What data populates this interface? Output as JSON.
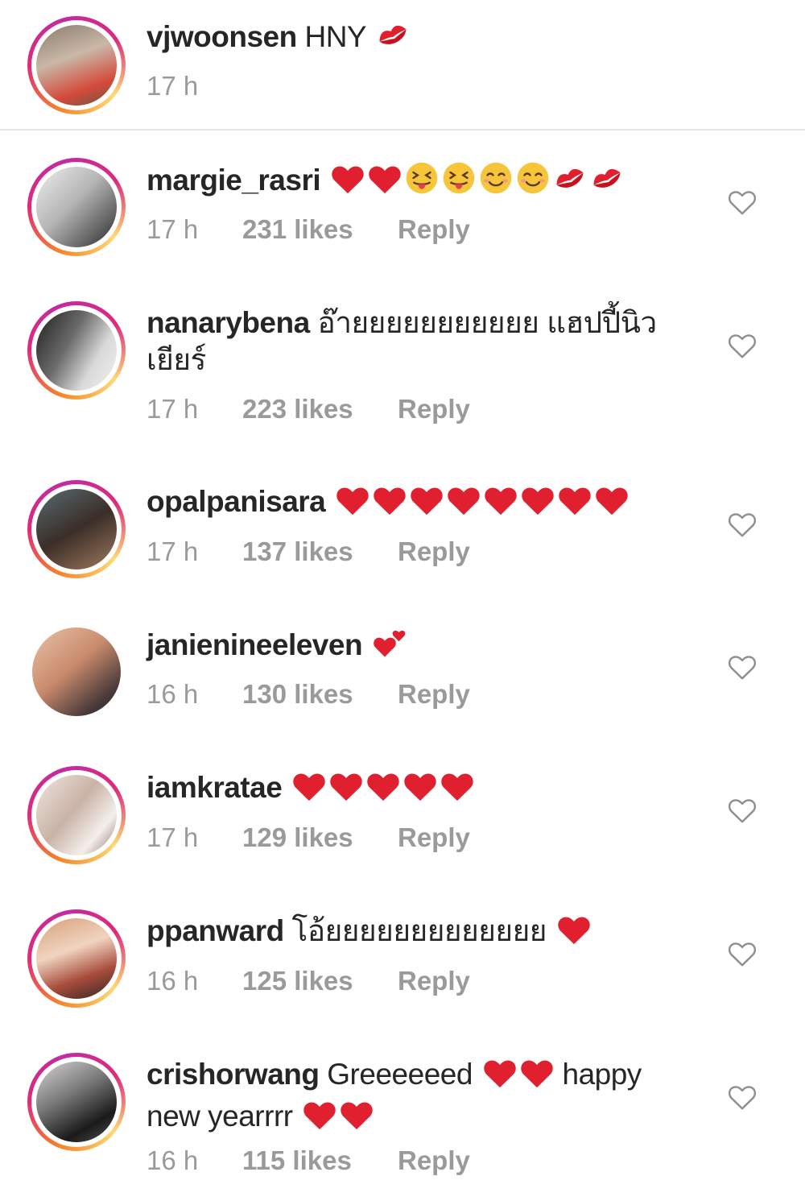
{
  "caption": {
    "username": "vjwoonsen",
    "text": "HNY",
    "emojis": [
      "kiss-mark"
    ],
    "time": "17 h"
  },
  "comments": [
    {
      "username": "margie_rasri",
      "text": "",
      "emojis": [
        "red-heart",
        "red-heart",
        "squinting-tongue-face",
        "squinting-tongue-face",
        "smiling-face",
        "smiling-face",
        "kiss-mark",
        "kiss-mark"
      ],
      "time": "17 h",
      "likes": "231 likes",
      "reply": "Reply"
    },
    {
      "username": "nanarybena",
      "text": "อ๊ายยยยยยยยยยย แฮปปี้นิวเยียร์",
      "emojis": [],
      "time": "17 h",
      "likes": "223 likes",
      "reply": "Reply"
    },
    {
      "username": "opalpanisara",
      "text": "",
      "emojis": [
        "red-heart",
        "red-heart",
        "red-heart",
        "red-heart",
        "red-heart",
        "red-heart",
        "red-heart",
        "red-heart"
      ],
      "time": "17 h",
      "likes": "137 likes",
      "reply": "Reply"
    },
    {
      "username": "janienineeleven",
      "text": "",
      "emojis": [
        "two-hearts"
      ],
      "time": "16 h",
      "likes": "130 likes",
      "reply": "Reply"
    },
    {
      "username": "iamkratae",
      "text": "",
      "emojis": [
        "red-heart",
        "red-heart",
        "red-heart",
        "red-heart",
        "red-heart"
      ],
      "time": "17 h",
      "likes": "129 likes",
      "reply": "Reply"
    },
    {
      "username": "ppanward",
      "text": "โอ้ยยยยยยยยยยยยย",
      "emojis": [
        "red-heart"
      ],
      "time": "16 h",
      "likes": "125 likes",
      "reply": "Reply"
    },
    {
      "username": "crishorwang",
      "text": "Greeeeeed",
      "text_after": "happy new yearrrr",
      "emojis": [
        "red-heart",
        "red-heart"
      ],
      "emojis_after": [
        "red-heart",
        "red-heart"
      ],
      "time": "16 h",
      "likes": "115 likes",
      "reply": "Reply"
    }
  ],
  "colors": {
    "text": "#262626",
    "meta": "#9a9a9a",
    "heart": "#e0202e",
    "divider": "#e6e6e6"
  }
}
